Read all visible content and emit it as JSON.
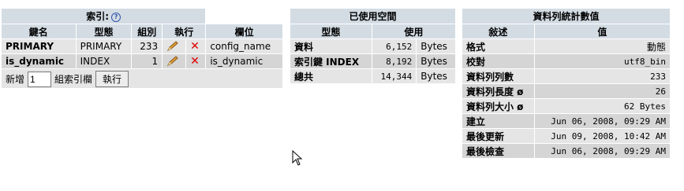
{
  "indexes": {
    "title": "索引:",
    "help_glyph": "?",
    "headers": [
      "鍵名",
      "型態",
      "組別",
      "執行",
      "欄位"
    ],
    "rows": [
      {
        "key": "PRIMARY",
        "type": "PRIMARY",
        "cardinality": "233",
        "column": "config_name"
      },
      {
        "key": "is_dynamic",
        "type": "INDEX",
        "cardinality": "1",
        "column": "is_dynamic"
      }
    ],
    "add_label": "新增",
    "add_value": "1",
    "add_suffix": "組索引欄",
    "go_label": "執行"
  },
  "space": {
    "title": "已使用空間",
    "headers": [
      "型態",
      "使用"
    ],
    "rows": [
      {
        "type": "資料",
        "value": "6,152",
        "unit": "Bytes"
      },
      {
        "type": "索引鍵 INDEX",
        "value": "8,192",
        "unit": "Bytes"
      },
      {
        "type": "總共",
        "value": "14,344",
        "unit": "Bytes"
      }
    ]
  },
  "stats": {
    "title": "資料列統計數值",
    "headers": [
      "敍述",
      "值"
    ],
    "rows": [
      {
        "label": "格式",
        "value": "動態"
      },
      {
        "label": "校對",
        "value": "utf8_bin"
      },
      {
        "label": "資料列列數",
        "value": "233"
      },
      {
        "label": "資料列長度 ø",
        "value": "26"
      },
      {
        "label": "資料列大小 ø",
        "value": "62 Bytes"
      },
      {
        "label": "建立",
        "value": "Jun 06, 2008, 09:29 AM"
      },
      {
        "label": "最後更新",
        "value": "Jun 09, 2008, 10:42 AM"
      },
      {
        "label": "最後檢查",
        "value": "Jun 06, 2008, 09:29 AM"
      }
    ]
  }
}
